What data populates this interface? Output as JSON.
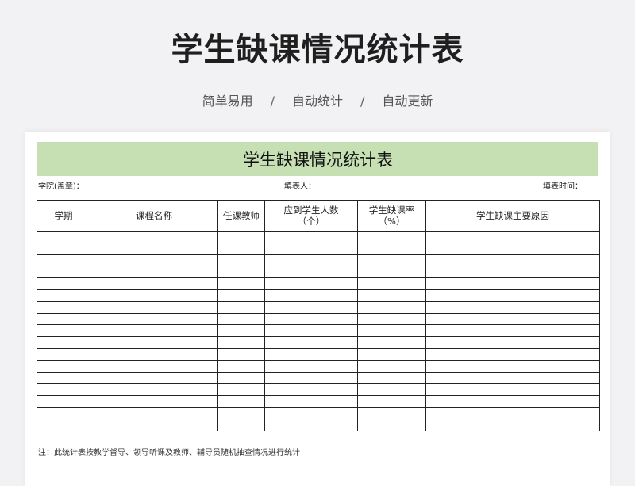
{
  "header": {
    "title": "学生缺课情况统计表",
    "features": [
      "简单易用",
      "自动统计",
      "自动更新"
    ],
    "separator": "/"
  },
  "sheet": {
    "banner_title": "学生缺课情况统计表",
    "meta": {
      "college": "学院(盖章)：",
      "filler": "填表人：",
      "date": "填表时间："
    },
    "table": {
      "columns": [
        {
          "line1": "学期",
          "line2": ""
        },
        {
          "line1": "课程名称",
          "line2": ""
        },
        {
          "line1": "任课教师",
          "line2": ""
        },
        {
          "line1": "应到学生人数",
          "line2": "（个）"
        },
        {
          "line1": "学生缺课率",
          "line2": "（%）"
        },
        {
          "line1": "学生缺课主要原因",
          "line2": ""
        }
      ],
      "empty_rows": 17
    },
    "note": "注：此统计表按教学督导、领导听课及教师、辅导员随机抽查情况进行统计"
  },
  "colors": {
    "banner": "#c6dfb3",
    "background": "#f2f2f4"
  }
}
